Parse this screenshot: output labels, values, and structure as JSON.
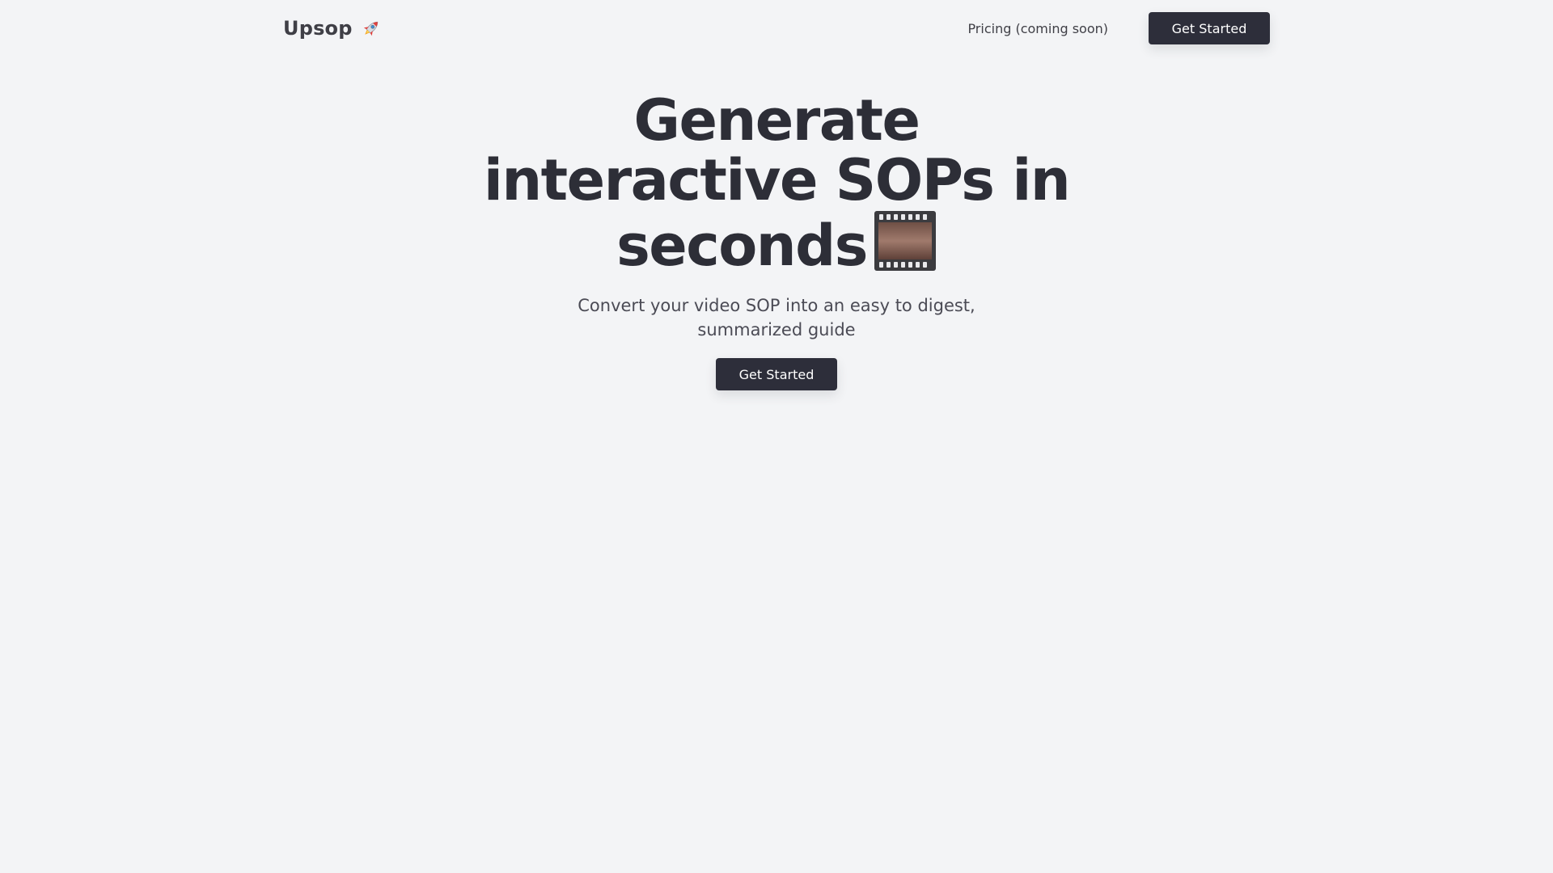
{
  "header": {
    "brand": "Upsop",
    "brand_icon": "rocket-icon",
    "nav": {
      "pricing_label": "Pricing (coming soon)",
      "get_started_label": "Get Started"
    }
  },
  "hero": {
    "title_lines": [
      "Generate",
      "interactive SOPs in",
      "seconds"
    ],
    "title_icon": "film-frames-icon",
    "subtitle": "Convert your video SOP into an easy to digest, summarized guide",
    "cta_label": "Get Started"
  },
  "colors": {
    "background": "#f3f4f6",
    "primary_button": "#2d2e3a",
    "heading": "#2d2e37",
    "text": "#4b4b55"
  }
}
